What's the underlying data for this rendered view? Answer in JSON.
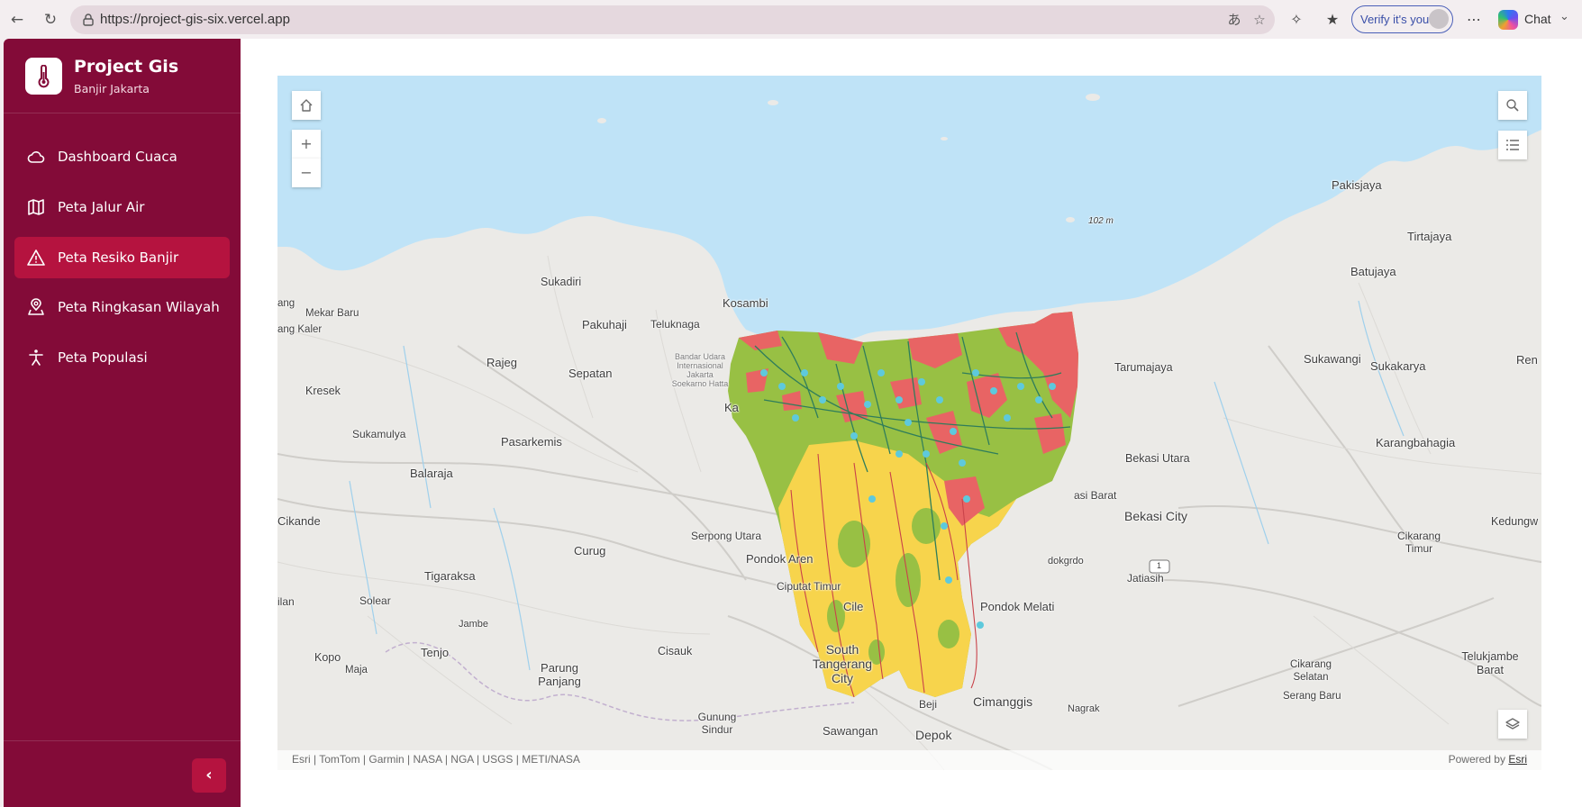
{
  "browser": {
    "url": "https://project-gis-six.vercel.app",
    "verify_label": "Verify it's you",
    "chat_label": "Chat"
  },
  "sidebar": {
    "title": "Project Gis",
    "subtitle": "Banjir Jakarta",
    "items": [
      {
        "label": "Dashboard Cuaca",
        "icon": "cloud-icon",
        "active": false
      },
      {
        "label": "Peta Jalur Air",
        "icon": "map-icon",
        "active": false
      },
      {
        "label": "Peta Resiko Banjir",
        "icon": "warning-triangle-icon",
        "active": true
      },
      {
        "label": "Peta Ringkasan Wilayah",
        "icon": "location-pin-icon",
        "active": false
      },
      {
        "label": "Peta Populasi",
        "icon": "person-icon",
        "active": false
      }
    ],
    "collapse_glyph": "‹"
  },
  "map": {
    "places": [
      {
        "key": "pakisjaya",
        "text": "Pakisjaya"
      },
      {
        "key": "tirtajaya",
        "text": "Tirtajaya"
      },
      {
        "key": "batujaya",
        "text": "Batujaya"
      },
      {
        "key": "sukawangi",
        "text": "Sukawangi"
      },
      {
        "key": "sukakarya",
        "text": "Sukakarya"
      },
      {
        "key": "ren",
        "text": "Ren"
      },
      {
        "key": "elev",
        "text": "102 m"
      },
      {
        "key": "sukadiri",
        "text": "Sukadiri"
      },
      {
        "key": "kosambi",
        "text": "Kosambi"
      },
      {
        "key": "mekarbaru",
        "text": "Mekar Baru"
      },
      {
        "key": "ang",
        "text": "ang"
      },
      {
        "key": "angkaler",
        "text": "ang Kaler"
      },
      {
        "key": "pakuhaji",
        "text": "Pakuhaji"
      },
      {
        "key": "teluknaga",
        "text": "Teluknaga"
      },
      {
        "key": "rajeg",
        "text": "Rajeg"
      },
      {
        "key": "sepatan",
        "text": "Sepatan"
      },
      {
        "key": "bandara",
        "text": "Bandar Udara Internasional Jakarta Soekarno Hatta"
      },
      {
        "key": "kresek",
        "text": "Kresek"
      },
      {
        "key": "tarumajaya",
        "text": "Tarumajaya"
      },
      {
        "key": "sukamulya",
        "text": "Sukamulya"
      },
      {
        "key": "pasarkemis",
        "text": "Pasarkemis"
      },
      {
        "key": "balaraja",
        "text": "Balaraja"
      },
      {
        "key": "bekasiutara",
        "text": "Bekasi Utara"
      },
      {
        "key": "karangbahagia",
        "text": "Karangbahagia"
      },
      {
        "key": "bekasibarat",
        "text": "asi Barat"
      },
      {
        "key": "bekasicity",
        "text": "Bekasi City"
      },
      {
        "key": "cikande",
        "text": "Cikande"
      },
      {
        "key": "serpongutara",
        "text": "Serpong Utara"
      },
      {
        "key": "curug",
        "text": "Curug"
      },
      {
        "key": "pondokaren",
        "text": "Pondok Aren"
      },
      {
        "key": "cikarangtimur",
        "text": "Cikarang Timur"
      },
      {
        "key": "kedungw",
        "text": "Kedungw"
      },
      {
        "key": "tigaraksa",
        "text": "Tigaraksa"
      },
      {
        "key": "ciputat",
        "text": "Ciputat Timur"
      },
      {
        "key": "jatiasih",
        "text": "Jatiasih"
      },
      {
        "key": "solear",
        "text": "Solear"
      },
      {
        "key": "ilan",
        "text": "ilan"
      },
      {
        "key": "cile",
        "text": "Cile"
      },
      {
        "key": "pondokmelati",
        "text": "Pondok Melati"
      },
      {
        "key": "jambe",
        "text": "Jambe"
      },
      {
        "key": "kopo",
        "text": "Kopo"
      },
      {
        "key": "tenjo",
        "text": "Tenjo"
      },
      {
        "key": "cisauk",
        "text": "Cisauk"
      },
      {
        "key": "maja",
        "text": "Maja"
      },
      {
        "key": "parungpanjang",
        "text": "Parung Panjang"
      },
      {
        "key": "southtangerang",
        "text": "South Tangerang City"
      },
      {
        "key": "telukjambe",
        "text": "Telukjambe Barat"
      },
      {
        "key": "cikarangselatan",
        "text": "Cikarang Selatan"
      },
      {
        "key": "serangbaru",
        "text": "Serang Baru"
      },
      {
        "key": "beji",
        "text": "Beji"
      },
      {
        "key": "cimanggis",
        "text": "Cimanggis"
      },
      {
        "key": "nagrak",
        "text": "Nagrak"
      },
      {
        "key": "gunungsindur",
        "text": "Gunung Sindur"
      },
      {
        "key": "sawangan",
        "text": "Sawangan"
      },
      {
        "key": "depok",
        "text": "Depok"
      },
      {
        "key": "kal",
        "text": "Ka"
      },
      {
        "key": "hodokgrdo",
        "text": "dokgrdo"
      },
      {
        "key": "shield1",
        "text": "1"
      }
    ],
    "attribution": "Esri | TomTom | Garmin | NASA | NGA | USGS | METI/NASA",
    "powered_by": "Powered by",
    "powered_link": "Esri",
    "zoom_in_glyph": "+",
    "zoom_out_glyph": "−",
    "colors": {
      "water": "#bfe3f7",
      "land": "#ebeae7",
      "high_risk": "#e86464",
      "medium_risk": "#98c044",
      "low_risk": "#f7d44c",
      "waterway": "#2f7d5b",
      "station": "#5ec9dc"
    }
  }
}
